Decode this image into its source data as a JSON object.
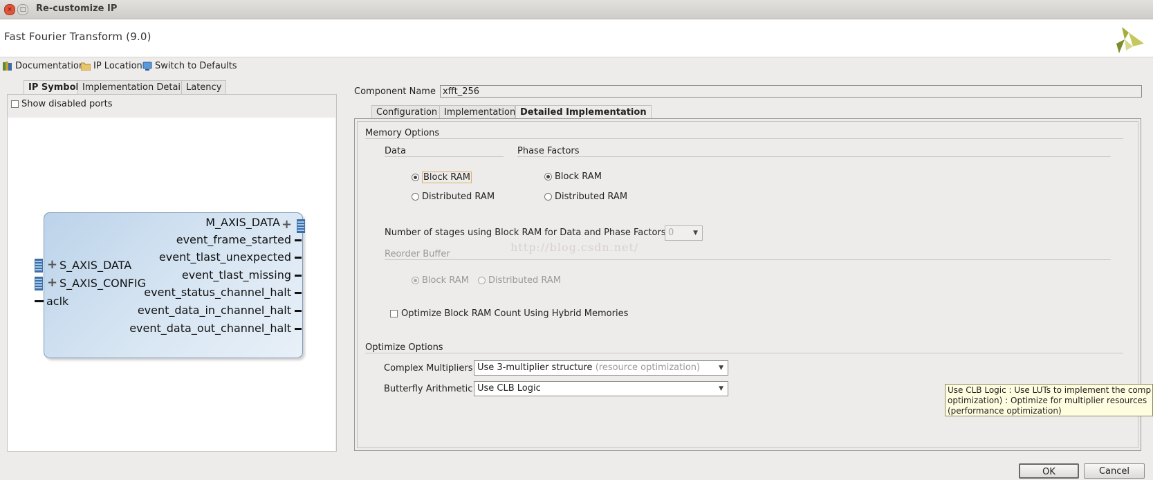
{
  "window": {
    "title": "Re-customize IP",
    "close_glyph": "×",
    "max_glyph": "□"
  },
  "header": {
    "ip_title": "Fast Fourier Transform (9.0)",
    "logo_icon": "xilinx-logo"
  },
  "toolbar": {
    "documentation": "Documentation",
    "ip_location": "IP Location",
    "switch_defaults": "Switch to Defaults"
  },
  "left": {
    "tabs": [
      "IP Symbol",
      "Implementation Details",
      "Latency"
    ],
    "show_disabled_ports": "Show disabled ports",
    "symbol": {
      "left_ports": [
        "S_AXIS_DATA",
        "S_AXIS_CONFIG",
        "aclk"
      ],
      "right_ports": [
        "M_AXIS_DATA",
        "event_frame_started",
        "event_tlast_unexpected",
        "event_tlast_missing",
        "event_status_channel_halt",
        "event_data_in_channel_halt",
        "event_data_out_channel_halt"
      ]
    }
  },
  "right": {
    "component_label": "Component Name",
    "component_value": "xfft_256",
    "tabs": [
      "Configuration",
      "Implementation",
      "Detailed Implementation"
    ],
    "memory_options": "Memory Options",
    "data_label": "Data",
    "phase_label": "Phase Factors",
    "data_block_ram": "Block RAM",
    "data_dist_ram": "Distributed RAM",
    "phase_block_ram": "Block RAM",
    "phase_dist_ram": "Distributed RAM",
    "stages_label": "Number of stages using Block RAM for Data and Phase Factors",
    "stages_value": "0",
    "reorder_buffer": "Reorder Buffer",
    "reorder_block_ram": "Block RAM",
    "reorder_dist_ram": "Distributed RAM",
    "optimize_hybrid": "Optimize Block RAM Count Using Hybrid Memories",
    "optimize_options": "Optimize Options",
    "complex_mult_label": "Complex Multipliers",
    "complex_mult_value": "Use 3-multiplier structure",
    "complex_mult_hint": "(resource optimization)",
    "butterfly_label": "Butterfly Arithmetic",
    "butterfly_value": "Use CLB Logic",
    "watermark": "http://blog.csdn.net/"
  },
  "tooltip": {
    "line1": "Use CLB Logic : Use LUTs to implement the comp",
    "line2": "optimization) : Optimize for multiplier resources",
    "line3": "(performance optimization)"
  },
  "buttons": {
    "ok": "OK",
    "cancel": "Cancel"
  }
}
